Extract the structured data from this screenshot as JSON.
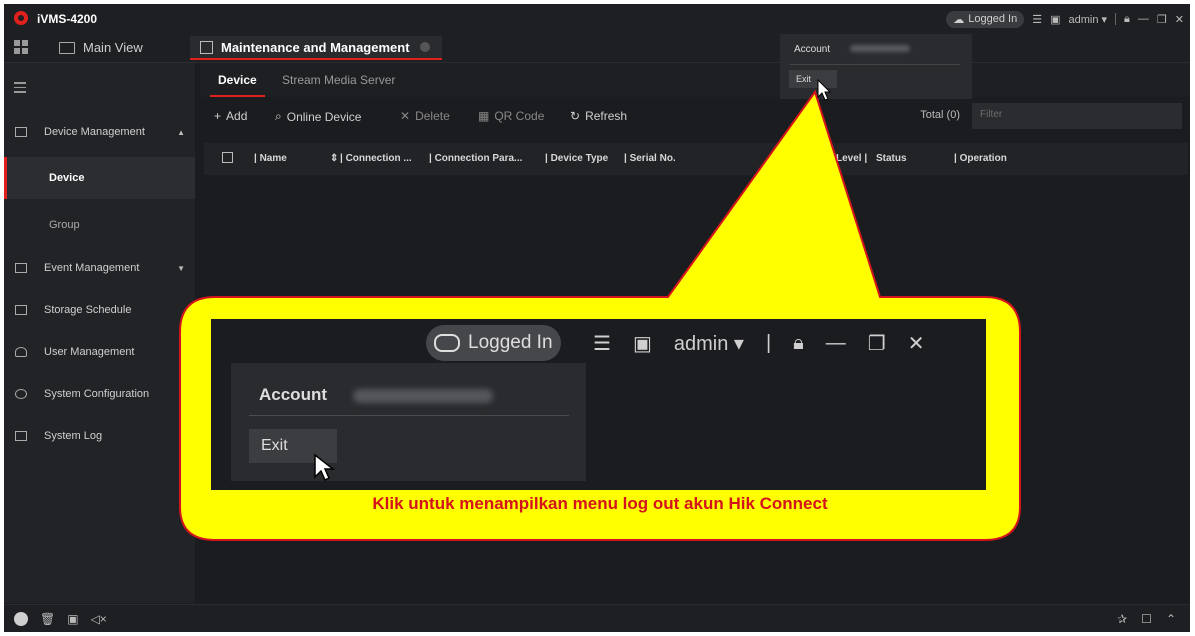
{
  "app": {
    "title": "iVMS-4200"
  },
  "titlebar": {
    "logged_in": "Logged In",
    "user": "admin"
  },
  "tabs": {
    "main_view": "Main View",
    "maintenance": "Maintenance and Management"
  },
  "sidebar": {
    "device_management": "Device Management",
    "device": "Device",
    "group": "Group",
    "event_management": "Event Management",
    "storage_schedule": "Storage Schedule",
    "user_management": "User Management",
    "system_configuration": "System Configuration",
    "system_log": "System Log"
  },
  "subtabs": {
    "device": "Device",
    "stream_media_server": "Stream Media Server"
  },
  "toolbar": {
    "add": "Add",
    "online_device": "Online Device",
    "delete": "Delete",
    "qr_code": "QR Code",
    "refresh": "Refresh",
    "total": "Total (0)",
    "filter_placeholder": "Filter"
  },
  "table": {
    "columns": [
      "Name",
      "Connection ...",
      "Connection Para...",
      "Device Type",
      "Serial No.",
      "Level",
      "Status",
      "Operation"
    ]
  },
  "account_menu": {
    "account_label": "Account",
    "exit_label": "Exit"
  },
  "callout": {
    "logged_in": "Logged In",
    "user": "admin",
    "account_label": "Account",
    "exit_label": "Exit",
    "caption": "Klik untuk menampilkan menu log out akun Hik Connect"
  },
  "colors": {
    "accent": "#e0201c",
    "callout_fill": "#ffff00",
    "callout_border": "#d4141c",
    "caption": "#d4141c"
  }
}
